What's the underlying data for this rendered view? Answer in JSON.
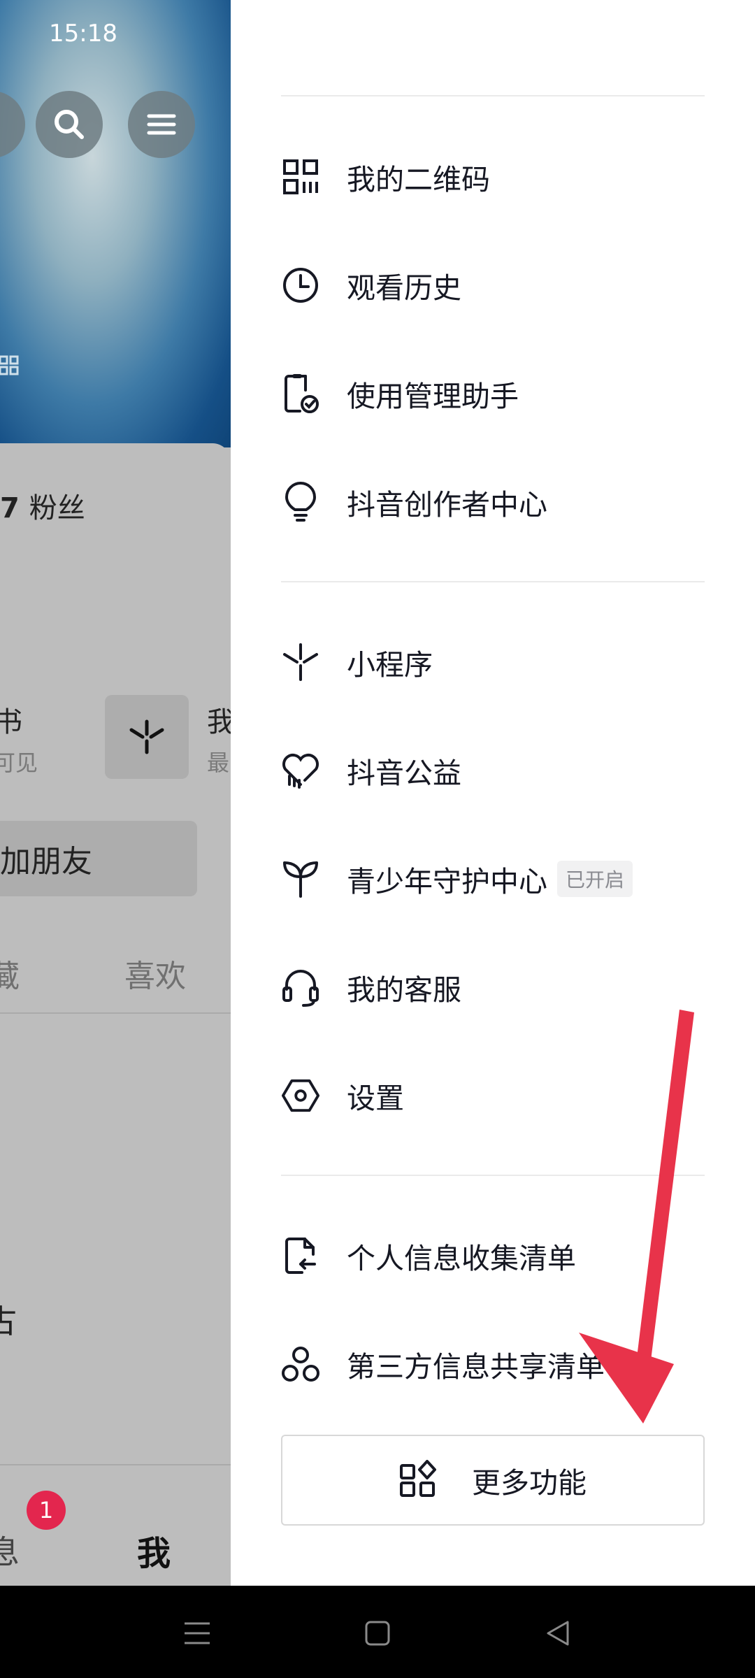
{
  "status_bar": {
    "time": "15:18"
  },
  "background_profile": {
    "fans_label": "粉丝",
    "book_label": "书",
    "book_sub": "可见",
    "wo_label": "我",
    "zui_sub": "最",
    "add_friend": "加朋友",
    "tabs": [
      "藏",
      "喜欢"
    ],
    "partial_char": "古",
    "nav_message": "息",
    "nav_message_badge": "1",
    "nav_me": "我"
  },
  "drawer": {
    "items": [
      {
        "label": "我的二维码",
        "icon": "qr-code-icon"
      },
      {
        "label": "观看历史",
        "icon": "clock-icon"
      },
      {
        "label": "使用管理助手",
        "icon": "phone-check-icon"
      },
      {
        "label": "抖音创作者中心",
        "icon": "lightbulb-icon"
      },
      {
        "label": "小程序",
        "icon": "miniapp-icon"
      },
      {
        "label": "抖音公益",
        "icon": "heart-charity-icon"
      },
      {
        "label": "青少年守护中心",
        "icon": "sprout-icon",
        "tag": "已开启"
      },
      {
        "label": "我的客服",
        "icon": "headset-icon"
      },
      {
        "label": "设置",
        "icon": "settings-hexagon-icon"
      },
      {
        "label": "个人信息收集清单",
        "icon": "document-return-icon"
      },
      {
        "label": "第三方信息共享清单",
        "icon": "share-circles-icon"
      }
    ],
    "more_button": {
      "label": "更多功能",
      "icon": "grid-diamond-icon"
    }
  },
  "annotation": {
    "arrow_color": "#e8334a"
  },
  "system_nav": {
    "buttons": [
      "menu-icon",
      "home-square-icon",
      "back-triangle-icon"
    ]
  }
}
